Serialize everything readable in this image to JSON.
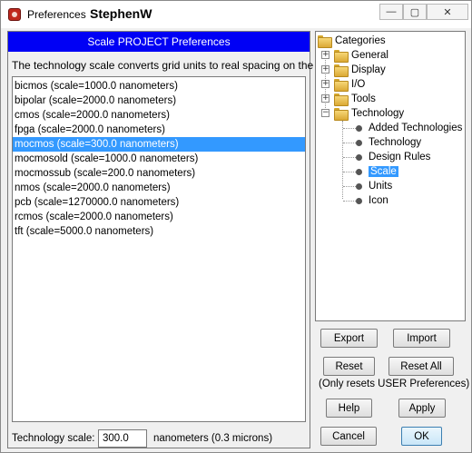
{
  "window": {
    "title_prefix": "Preferences",
    "title_user": "StephenW",
    "minimize_glyph": "—",
    "maximize_glyph": "▢",
    "close_glyph": "✕"
  },
  "panel": {
    "header": "Scale PROJECT Preferences",
    "description": "The technology scale converts grid units to real spacing on the chip:",
    "items": [
      "bicmos (scale=1000.0 nanometers)",
      "bipolar (scale=2000.0 nanometers)",
      "cmos (scale=2000.0 nanometers)",
      "fpga (scale=2000.0 nanometers)",
      "mocmos (scale=300.0 nanometers)",
      "mocmosold (scale=1000.0 nanometers)",
      "mocmossub (scale=200.0 nanometers)",
      "nmos (scale=2000.0 nanometers)",
      "pcb (scale=1270000.0 nanometers)",
      "rcmos (scale=2000.0 nanometers)",
      "tft (scale=5000.0 nanometers)"
    ],
    "selected_item": "mocmos (scale=300.0 nanometers)",
    "tech_scale_label": "Technology scale:",
    "tech_scale_value": "300.0",
    "tech_scale_units": "nanometers (0.3 microns)"
  },
  "tree": {
    "root": "Categories",
    "categories": [
      "General",
      "Display",
      "I/O",
      "Tools",
      "Technology"
    ],
    "expanded_category": "Technology",
    "technology_children": [
      "Added Technologies",
      "Technology",
      "Design Rules",
      "Scale",
      "Units",
      "Icon"
    ],
    "selected_child": "Scale"
  },
  "buttons": {
    "export": "Export",
    "import": "Import",
    "reset": "Reset",
    "reset_all": "Reset All",
    "reset_note": "(Only resets USER Preferences)",
    "help": "Help",
    "apply": "Apply",
    "cancel": "Cancel",
    "ok": "OK"
  }
}
